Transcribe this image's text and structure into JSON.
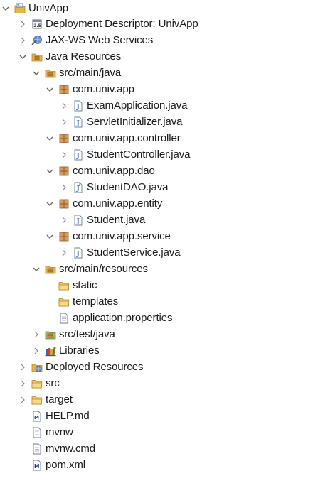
{
  "tree": {
    "project": "UnivApp",
    "items": {
      "deployment_descriptor": "Deployment Descriptor: UnivApp",
      "jaxws": "JAX-WS Web Services",
      "java_resources": "Java Resources",
      "src_main_java": "src/main/java",
      "pkg_app": "com.univ.app",
      "exam_application": "ExamApplication.java",
      "servlet_initializer": "ServletInitializer.java",
      "pkg_controller": "com.univ.app.controller",
      "student_controller": "StudentController.java",
      "pkg_dao": "com.univ.app.dao",
      "student_dao": "StudentDAO.java",
      "pkg_entity": "com.univ.app.entity",
      "student": "Student.java",
      "pkg_service": "com.univ.app.service",
      "student_service": "StudentService.java",
      "src_main_resources": "src/main/resources",
      "static": "static",
      "templates": "templates",
      "application_properties": "application.properties",
      "src_test_java": "src/test/java",
      "libraries": "Libraries",
      "deployed_resources": "Deployed Resources",
      "src": "src",
      "target": "target",
      "help_md": "HELP.md",
      "mvnw": "mvnw",
      "mvnw_cmd": "mvnw.cmd",
      "pom_xml": "pom.xml"
    }
  },
  "icons": {
    "project": "web-project-icon",
    "deployment_descriptor": "deployment-descriptor-icon",
    "jaxws": "web-services-icon",
    "java_resources": "java-resources-icon",
    "source_folder": "source-folder-icon",
    "package": "package-icon",
    "java_file": "java-file-icon",
    "interface_file": "java-interface-file-icon",
    "folder": "folder-icon",
    "properties_file": "properties-file-icon",
    "test_folder": "test-source-folder-icon",
    "libraries": "libraries-icon",
    "deployed_resources": "deployed-resources-icon",
    "text_file": "text-file-icon",
    "markdown_file": "markdown-file-icon",
    "maven_pom": "maven-pom-icon"
  },
  "colors": {
    "text": "#1a1a1a",
    "twisty": "#777777",
    "folder": "#e8b44a",
    "package": "#b87333",
    "java_blue": "#3568a8",
    "background": "#ffffff"
  }
}
